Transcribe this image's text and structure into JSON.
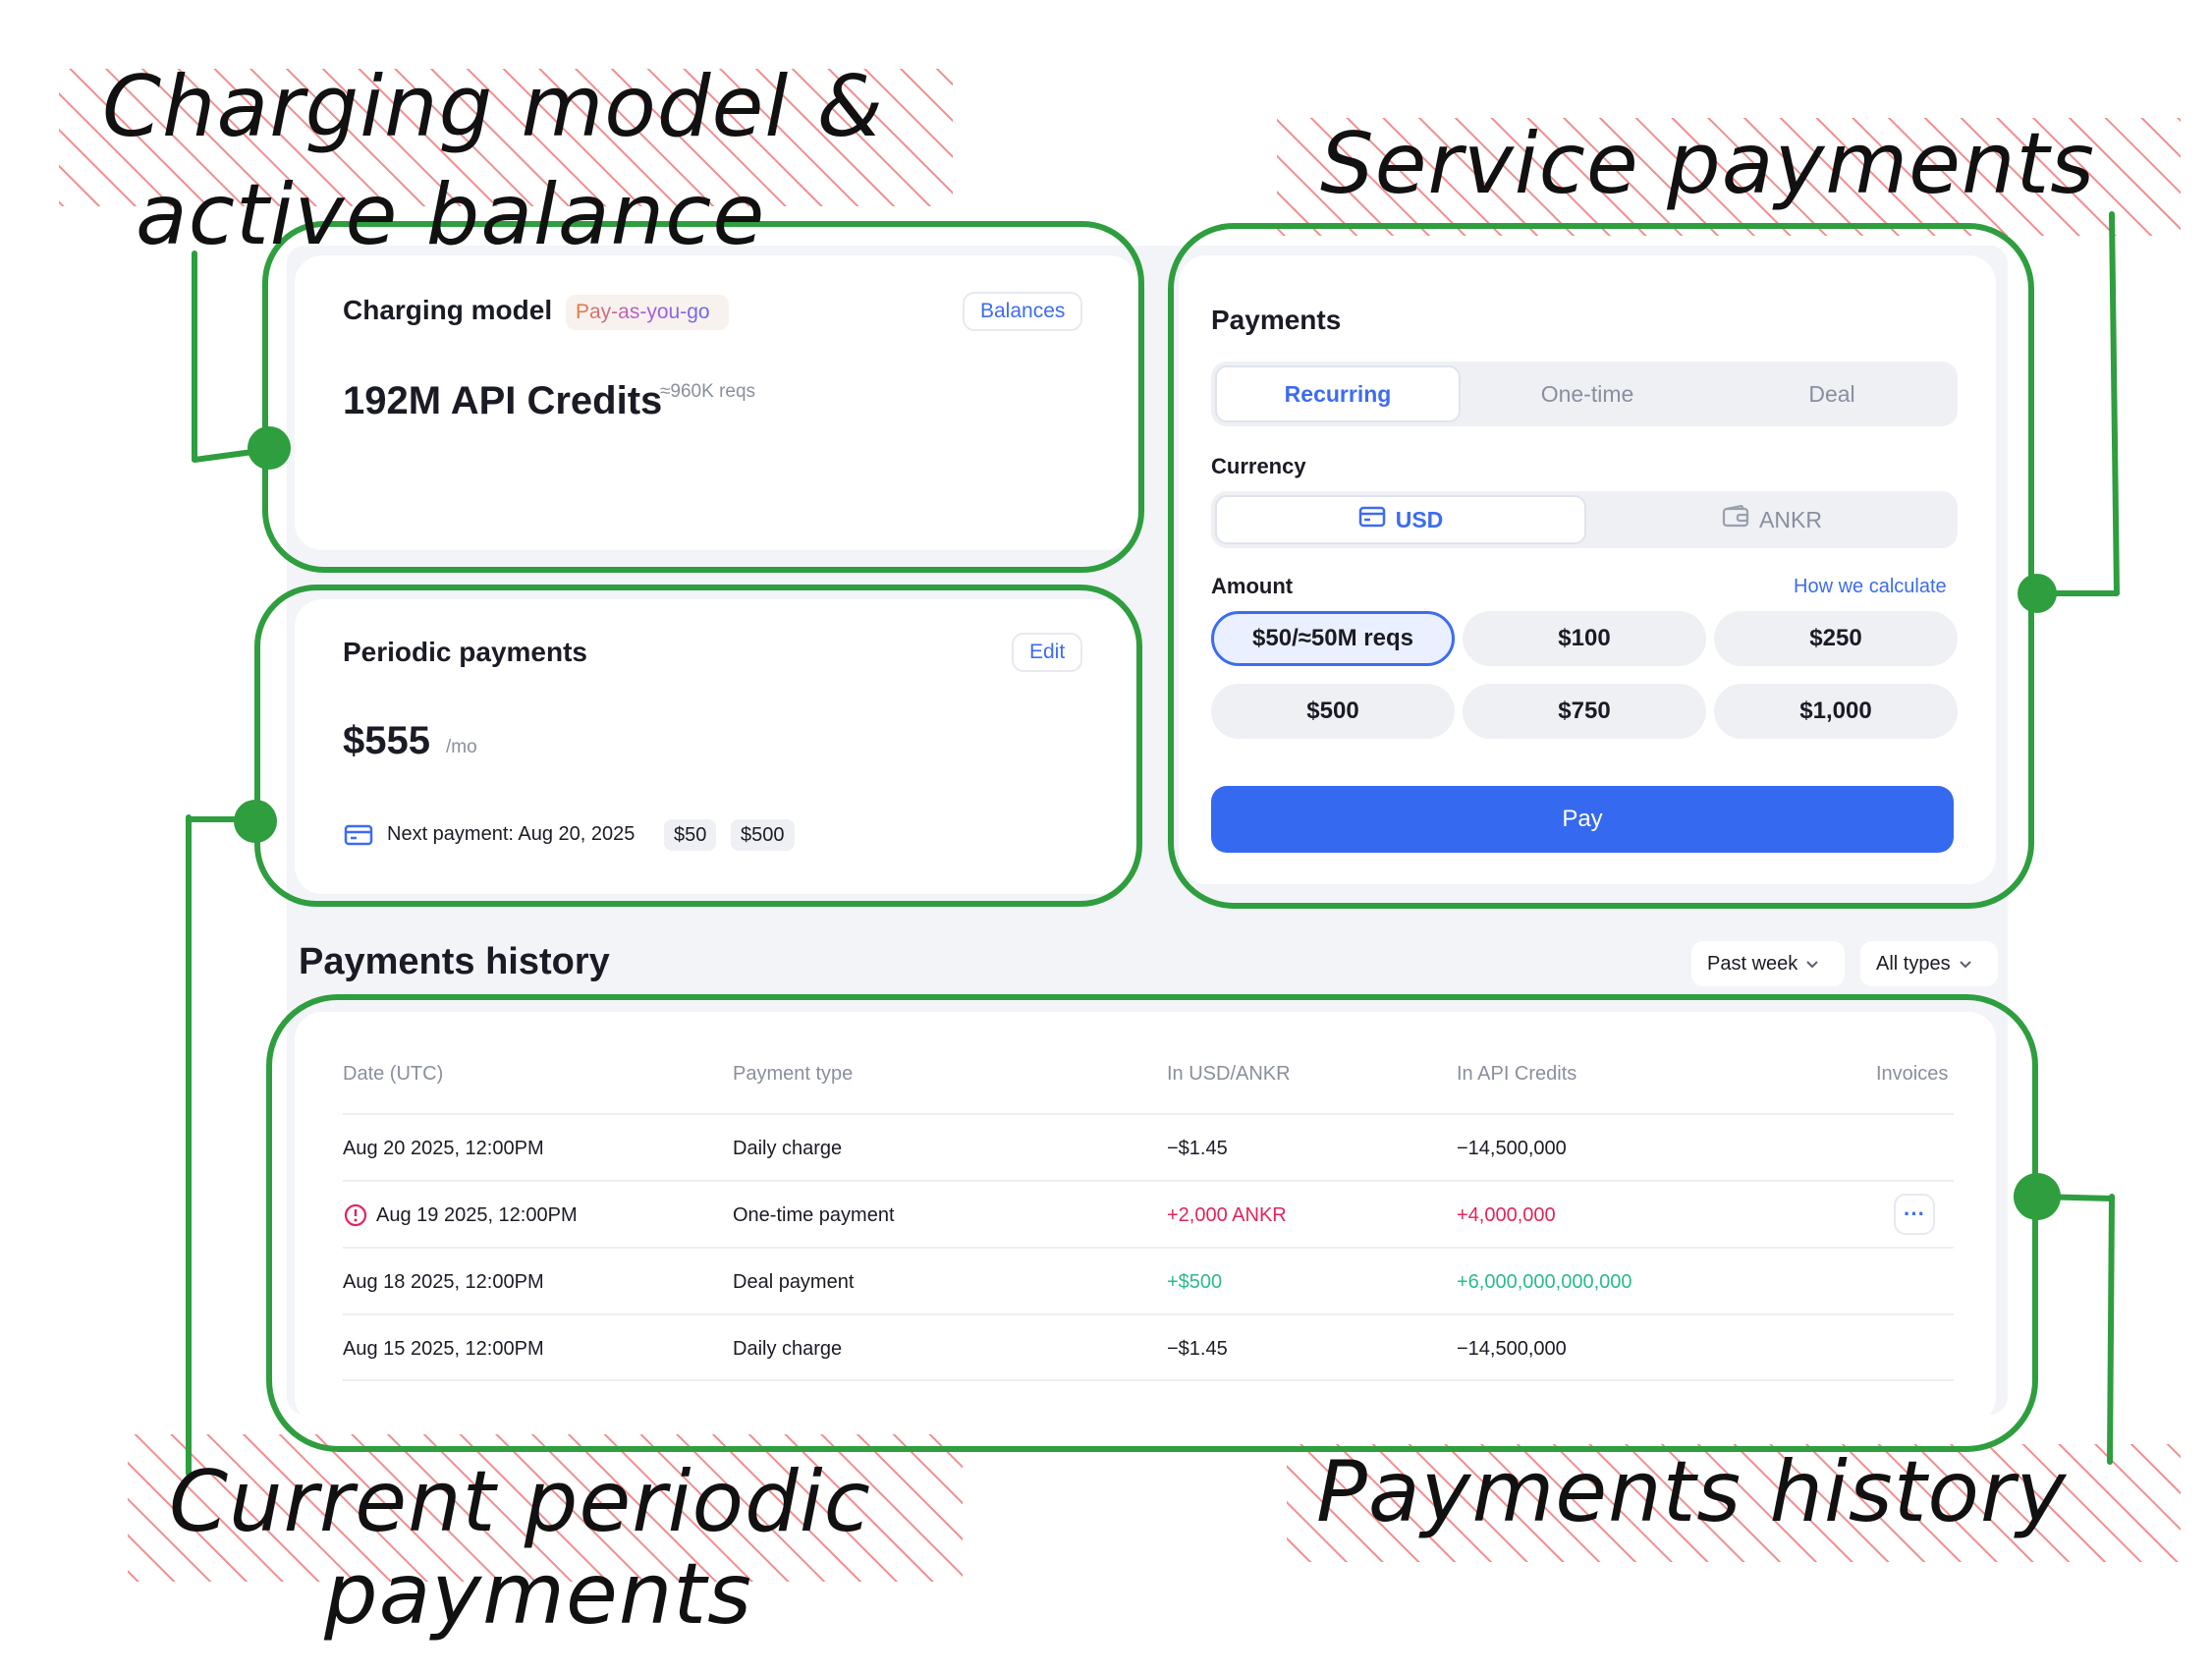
{
  "annotations": {
    "charging_line1": "Charging model &",
    "charging_line2": "active balance",
    "service": "Service payments",
    "periodic_line1": "Current periodic",
    "periodic_line2": "payments",
    "history": "Payments history"
  },
  "charging": {
    "title": "Charging model",
    "tag": "Pay-as-you-go",
    "balances_button": "Balances",
    "credits": "192M API Credits",
    "reqs": "≈960K reqs"
  },
  "periodic": {
    "title": "Periodic payments",
    "edit_button": "Edit",
    "amount": "$555",
    "unit": "/mo",
    "next_payment": "Next payment: Aug 20, 2025",
    "chips": [
      "$50",
      "$500"
    ]
  },
  "payments": {
    "title": "Payments",
    "tabs": [
      "Recurring",
      "One-time",
      "Deal"
    ],
    "active_tab": "Recurring",
    "currency_label": "Currency",
    "currencies": [
      "USD",
      "ANKR"
    ],
    "active_currency": "USD",
    "amount_label": "Amount",
    "how_link": "How we calculate",
    "amounts": [
      "$50/≈50M reqs",
      "$100",
      "$250",
      "$500",
      "$750",
      "$1,000"
    ],
    "selected_amount": "$50/≈50M reqs",
    "pay_button": "Pay"
  },
  "history": {
    "title": "Payments history",
    "filters": [
      "Past week",
      "All types"
    ],
    "columns": [
      "Date (UTC)",
      "Payment type",
      "In USD/ANKR",
      "In API Credits",
      "Invoices"
    ],
    "rows": [
      {
        "date": "Aug 20 2025, 12:00PM",
        "type": "Daily charge",
        "amount": "−$1.45",
        "credits": "−14,500,000"
      },
      {
        "date": "Aug 19 2025, 12:00PM",
        "type": "One-time payment",
        "amount": "+2,000 ANKR",
        "credits": "+4,000,000",
        "invoice": "···"
      },
      {
        "date": "Aug 18 2025, 12:00PM",
        "type": "Deal payment",
        "amount": "+$500",
        "credits": "+6,000,000,000,000"
      },
      {
        "date": "Aug 15 2025, 12:00PM",
        "type": "Daily charge",
        "amount": "−$1.45",
        "credits": "−14,500,000"
      }
    ]
  },
  "colors": {
    "accent": "#3569f0",
    "annotation_green": "#2e9e3e",
    "annotation_hatch": "#f07a7a",
    "negative": "#e0265a",
    "positive": "#2bbb8b"
  }
}
